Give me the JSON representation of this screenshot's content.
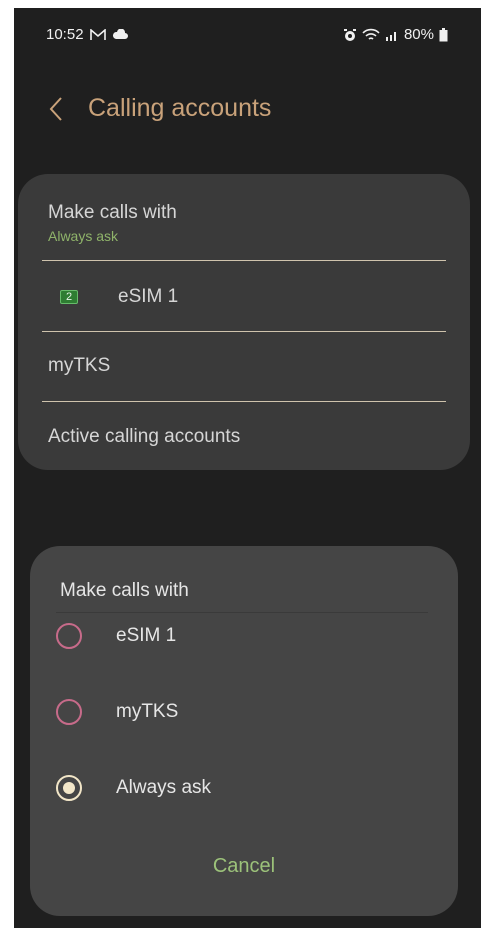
{
  "status_bar": {
    "time": "10:52",
    "battery": "80%",
    "left_icons": [
      "gmail-icon",
      "cloud-icon"
    ],
    "right_icons": [
      "alarm-icon",
      "wifi-icon",
      "signal-icon",
      "battery-icon"
    ]
  },
  "header": {
    "title": "Calling accounts",
    "back_icon": "chevron-left-icon"
  },
  "settings": {
    "make_calls_with": {
      "title": "Make calls with",
      "value": "Always ask"
    },
    "esim": {
      "badge": "2",
      "label": "eSIM 1"
    },
    "mytks": {
      "label": "myTKS"
    },
    "active_accounts": {
      "label": "Active calling accounts"
    }
  },
  "dialog": {
    "title": "Make calls with",
    "options": [
      {
        "label": "eSIM 1",
        "selected": false
      },
      {
        "label": "myTKS",
        "selected": false
      },
      {
        "label": "Always ask",
        "selected": true
      }
    ],
    "cancel_label": "Cancel"
  },
  "colors": {
    "background": "#1f1f1f",
    "title": "#c9a27a",
    "accent_green": "#9cc27a",
    "radio_unselected": "#c76b8a",
    "radio_selected": "#f2e6c8"
  }
}
